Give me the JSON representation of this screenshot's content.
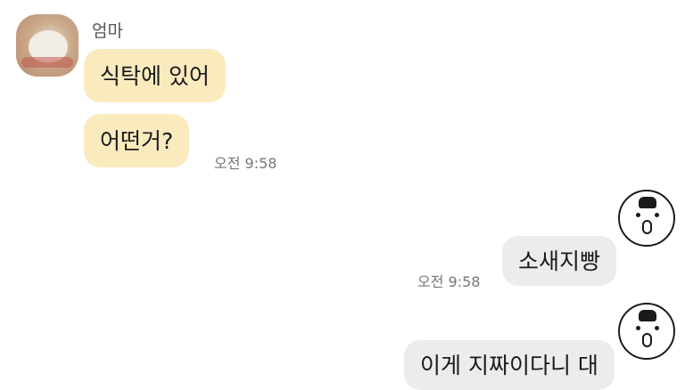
{
  "chat": {
    "contact_name": "엄마",
    "received": [
      {
        "text": "식탁에 있어"
      },
      {
        "text": "어떤거?"
      }
    ],
    "received_time": "오전 9:58",
    "sent": [
      {
        "text": "소새지빵"
      },
      {
        "text": "이게 지짜이다니 대"
      }
    ],
    "sent_time": "오전 9:58"
  },
  "colors": {
    "received_bubble": "#faebbf",
    "sent_bubble": "#ececec",
    "background": "#ffffff"
  },
  "icons": {
    "contact_avatar": "hamster-photo-avatar",
    "self_avatar": "cartoon-face-avatar"
  }
}
